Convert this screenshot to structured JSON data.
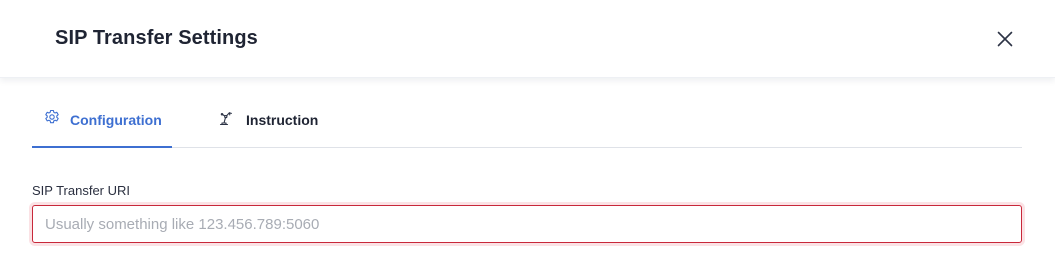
{
  "modal": {
    "title": "SIP Transfer Settings",
    "close_icon": "close-icon"
  },
  "tabs": [
    {
      "label": "Configuration",
      "icon": "gear-icon",
      "active": true
    },
    {
      "label": "Instruction",
      "icon": "robot-arm-icon",
      "active": false
    }
  ],
  "form": {
    "sip_uri": {
      "label": "SIP Transfer URI",
      "value": "",
      "placeholder": "Usually something like 123.456.789:5060",
      "state": "error"
    }
  },
  "colors": {
    "accent": "#3d6fd1",
    "error_border": "#c8283a",
    "text": "#1f2433",
    "placeholder": "#a8acb4"
  }
}
